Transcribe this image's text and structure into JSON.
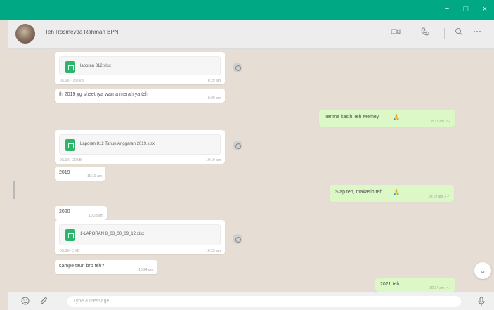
{
  "window": {
    "buttons": [
      "−",
      "□",
      "×"
    ]
  },
  "header": {
    "contact_name": "Teh Rosmeyda Rahman BPN",
    "icons": [
      "video-call-icon",
      "voice-call-icon",
      "search-icon",
      "more-options-icon"
    ]
  },
  "messages": [
    {
      "direction": "in",
      "type": "file",
      "file_name": "laporan 812.xlsx",
      "file_info": "XLSX · 753 kB",
      "time": "8:29 am"
    },
    {
      "direction": "in",
      "type": "text",
      "text": "th 2019 yg sheetnya warna merah ya teh",
      "time": "8:29 am"
    },
    {
      "direction": "out",
      "type": "text",
      "text": "Terima kasih Teh Memey",
      "emoji": "🙏",
      "time": "8:31 am ✓✓"
    },
    {
      "direction": "in",
      "type": "file",
      "file_name": "Laporan 812 Tahun Anggaran 2019.xlsx",
      "file_info": "XLSX · 20 kB",
      "time": "10:19 am"
    },
    {
      "direction": "in",
      "type": "text",
      "text": "2019",
      "time": "10:19 am"
    },
    {
      "direction": "out",
      "type": "text",
      "text": "Siap teh, makasih teh",
      "emoji": "🙏",
      "time": "10:19 am ✓✓"
    },
    {
      "direction": "in",
      "type": "text",
      "text": "2020",
      "time": "10:23 am"
    },
    {
      "direction": "in",
      "type": "file",
      "file_name": "1-LAPORAN 8_03_00_09_12.xlsx",
      "file_info": "XLSX · 3 kB",
      "time": "10:23 am"
    },
    {
      "direction": "in",
      "type": "text",
      "text": "sampe taun brp teh?",
      "time": "10:24 am"
    },
    {
      "direction": "out",
      "type": "text",
      "text": "2021 teh..",
      "time": "10:24 am ✓✓"
    }
  ],
  "composer": {
    "placeholder": "Type a message"
  },
  "icons": {
    "emoji": "emoji-icon",
    "attach": "attach-icon",
    "mic": "mic-icon",
    "scroll": "chevron-down-icon"
  }
}
